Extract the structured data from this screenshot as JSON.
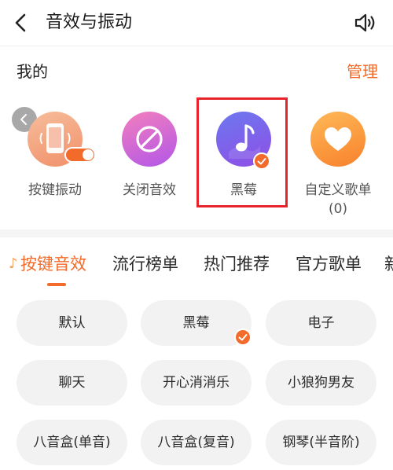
{
  "header": {
    "title": "音效与振动",
    "back_icon": "chevron-left-icon",
    "sound_icon": "speaker-icon"
  },
  "mine": {
    "title": "我的",
    "manage_label": "管理",
    "items": [
      {
        "label": "按键振动",
        "icon": "phone-vibrate-icon",
        "toggle": "on"
      },
      {
        "label": "关闭音效",
        "icon": "prohibited-icon"
      },
      {
        "label": "黑莓",
        "icon": "music-note-icon",
        "selected": true
      },
      {
        "label": "自定义歌单",
        "count": "(0)",
        "icon": "heart-icon"
      }
    ]
  },
  "tabs": [
    {
      "label": "按键音效",
      "active": true
    },
    {
      "label": "流行榜单"
    },
    {
      "label": "热门推荐"
    },
    {
      "label": "官方歌单"
    },
    {
      "label": "新"
    }
  ],
  "sounds": [
    {
      "label": "默认"
    },
    {
      "label": "黑莓",
      "selected": true
    },
    {
      "label": "电子"
    },
    {
      "label": "聊天"
    },
    {
      "label": "开心消消乐"
    },
    {
      "label": "小狼狗男友"
    },
    {
      "label": "八音盒(单音)"
    },
    {
      "label": "八音盒(复音)"
    },
    {
      "label": "钢琴(半音阶)"
    }
  ],
  "colors": {
    "accent": "#f26b2a",
    "highlight_box": "#e8232b"
  }
}
